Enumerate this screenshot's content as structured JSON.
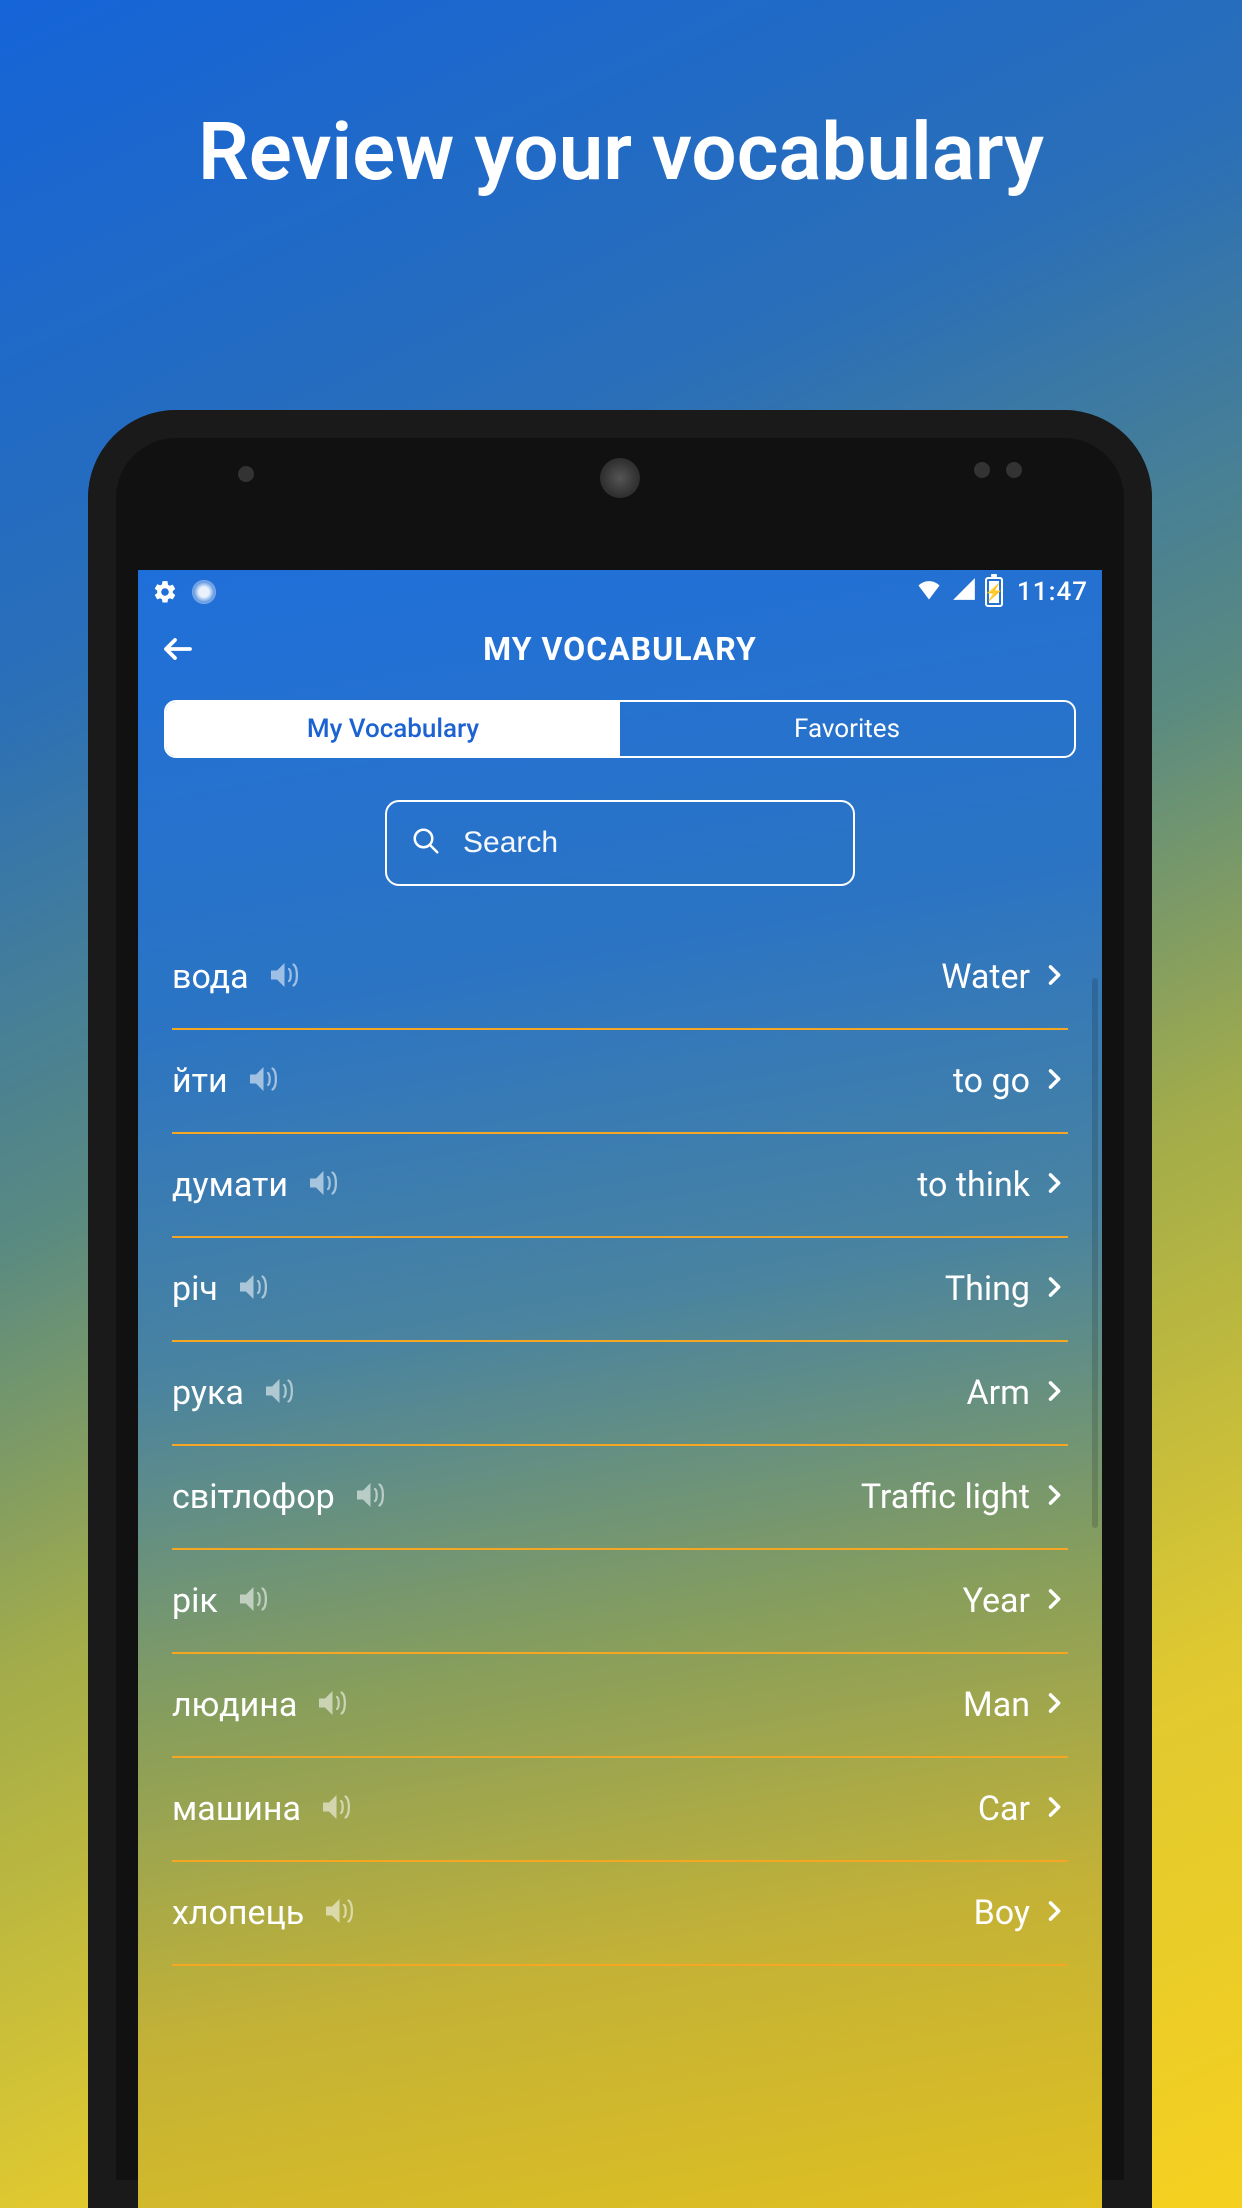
{
  "promo": {
    "title": "Review your vocabulary"
  },
  "status": {
    "time": "11:47"
  },
  "header": {
    "title": "MY VOCABULARY"
  },
  "tabs": {
    "vocab": "My Vocabulary",
    "fav": "Favorites"
  },
  "search": {
    "placeholder": "Search"
  },
  "words": [
    {
      "src": "вода",
      "dst": "Water"
    },
    {
      "src": "йти",
      "dst": "to go"
    },
    {
      "src": "думати",
      "dst": "to think"
    },
    {
      "src": "річ",
      "dst": "Thing"
    },
    {
      "src": "рука",
      "dst": "Arm"
    },
    {
      "src": "світлофор",
      "dst": "Traffic light"
    },
    {
      "src": "рік",
      "dst": "Year"
    },
    {
      "src": "людина",
      "dst": "Man"
    },
    {
      "src": "машина",
      "dst": "Car"
    },
    {
      "src": "хлопець",
      "dst": "Boy"
    }
  ]
}
